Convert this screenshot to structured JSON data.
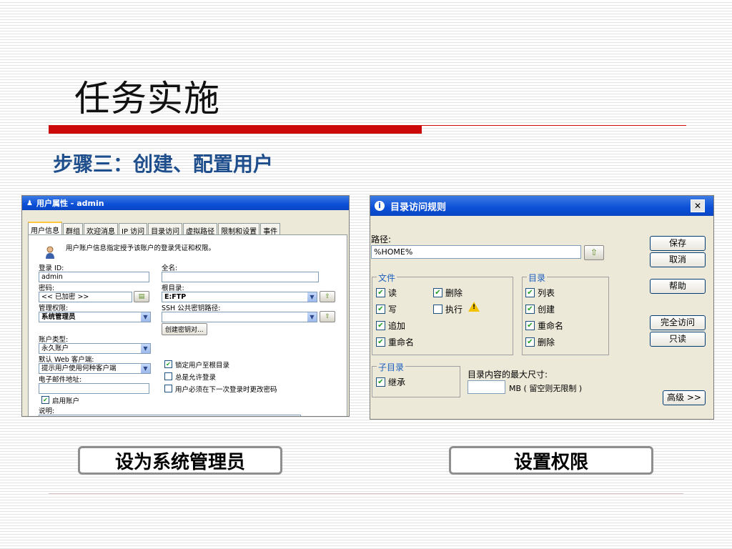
{
  "slide": {
    "title": "任务实施",
    "step": "步骤三：创建、配置用户",
    "accent_color": "#cc0a0a",
    "step_color": "#1f4e8c"
  },
  "user_dialog": {
    "title": "用户属性 - admin",
    "tabs": [
      "用户信息",
      "群组",
      "欢迎消息",
      "IP 访问",
      "目录访问",
      "虚拟路径",
      "限制和设置",
      "事件"
    ],
    "description": "用户账户信息指定授予该账户的登录凭证和权限。",
    "login_id_label": "登录 ID:",
    "login_id_value": "admin",
    "fullname_label": "全名:",
    "fullname_value": "",
    "password_label": "密码:",
    "password_value": "<< 已加密 >>",
    "root_dir_label": "根目录:",
    "root_dir_value": "E:FTP",
    "admin_label": "管理权限:",
    "admin_value": "系统管理员",
    "ssh_label": "SSH 公共密钥路径:",
    "ssh_value": "",
    "create_key_button": "创建密钥对...",
    "account_type_label": "账户类型:",
    "account_type_value": "永久账户",
    "web_client_label": "默认 Web 客户端:",
    "web_client_value": "提示用户使用何种客户端",
    "email_label": "电子邮件地址:",
    "email_value": "",
    "lock_root": "锁定用户至根目录",
    "allow_login": "总是允许登录",
    "must_change_pw": "用户必须在下一次登录时更改密码",
    "enable_account": "启用账户",
    "notes_label": "说明:"
  },
  "dir_dialog": {
    "title": "目录访问规则",
    "close_glyph": "✕",
    "path_label": "路径:",
    "path_value": "%HOME%",
    "file_group": "文件",
    "file_read": "读",
    "file_write": "写",
    "file_append": "追加",
    "file_rename": "重命名",
    "file_delete": "删除",
    "file_execute": "执行",
    "dir_group": "目录",
    "dir_list": "列表",
    "dir_create": "创建",
    "dir_rename": "重命名",
    "dir_delete": "删除",
    "subdir_group": "子目录",
    "inherit": "继承",
    "max_size_label": "目录内容的最大尺寸:",
    "max_size_value": "",
    "mb_note": "MB ( 留空则无限制 )",
    "buttons": {
      "save": "保存",
      "cancel": "取消",
      "help": "帮助",
      "full_access": "完全访问",
      "read_only": "只读",
      "advanced": "高级 >>"
    }
  },
  "captions": {
    "left": "设为系统管理员",
    "right": "设置权限"
  }
}
